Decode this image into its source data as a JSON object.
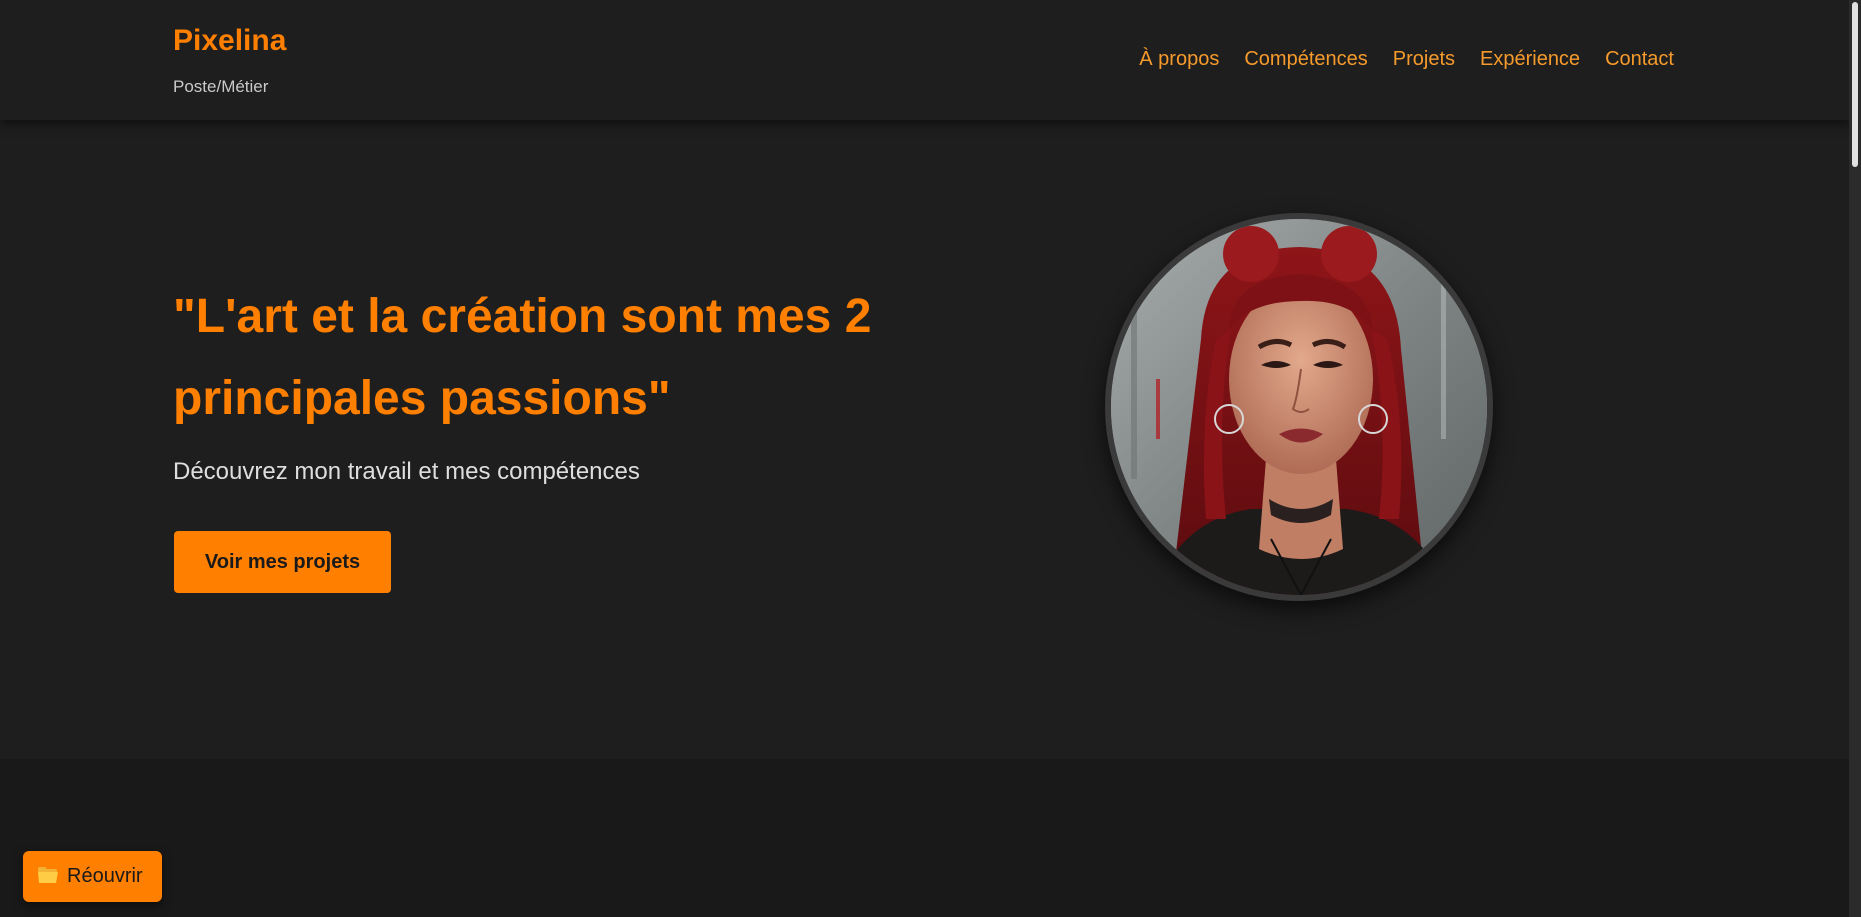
{
  "header": {
    "brand_name": "Pixelina",
    "brand_subtitle": "Poste/Métier",
    "nav": [
      "À propos",
      "Compétences",
      "Projets",
      "Expérience",
      "Contact"
    ]
  },
  "hero": {
    "title": "\"L'art et la création sont mes 2 principales passions\"",
    "subtitle": "Découvrez mon travail et mes compétences",
    "cta_label": "Voir mes projets"
  },
  "reopen_button": {
    "icon": "folder-open-icon",
    "label": "Réouvrir"
  },
  "colors": {
    "accent": "#ff7f00",
    "nav_link": "#f59a2c",
    "background": "#1e1e1e"
  }
}
